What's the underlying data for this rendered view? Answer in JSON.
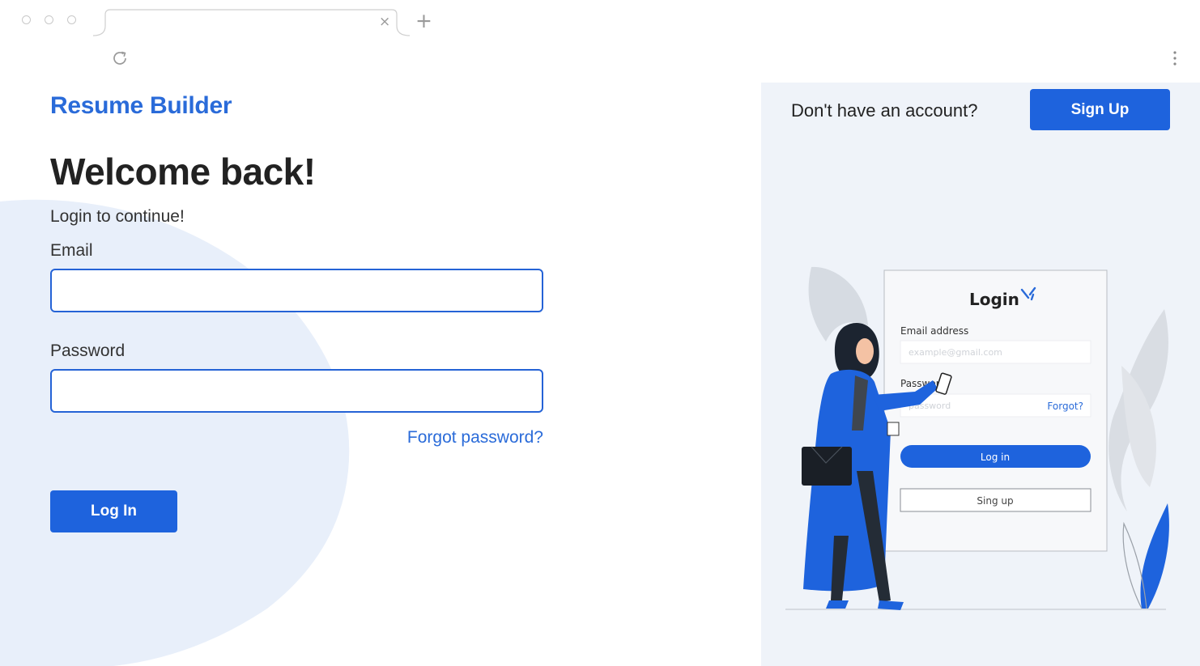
{
  "browser": {
    "tab_close_glyph": "×",
    "new_tab_glyph": "+"
  },
  "brand": {
    "name": "Resume Builder",
    "color": "#2a6bd9"
  },
  "login_form": {
    "title": "Welcome back!",
    "subtitle": "Login to continue!",
    "email_label": "Email",
    "email_value": "",
    "password_label": "Password",
    "password_value": "",
    "forgot_link": "Forgot password?",
    "submit_label": "Log In"
  },
  "signup_bar": {
    "prompt": "Don't have an account?",
    "button_label": "Sign Up"
  },
  "illustration": {
    "card_title": "Login",
    "email_label": "Email address",
    "email_placeholder": "example@gmail.com",
    "password_label": "Password",
    "password_placeholder": "password",
    "forgot_label": "Forgot?",
    "login_button": "Log in",
    "signup_button": "Sing up"
  },
  "colors": {
    "accent": "#1e63dd",
    "right_panel_bg": "#eff3f9",
    "blob": "#e8effa"
  }
}
